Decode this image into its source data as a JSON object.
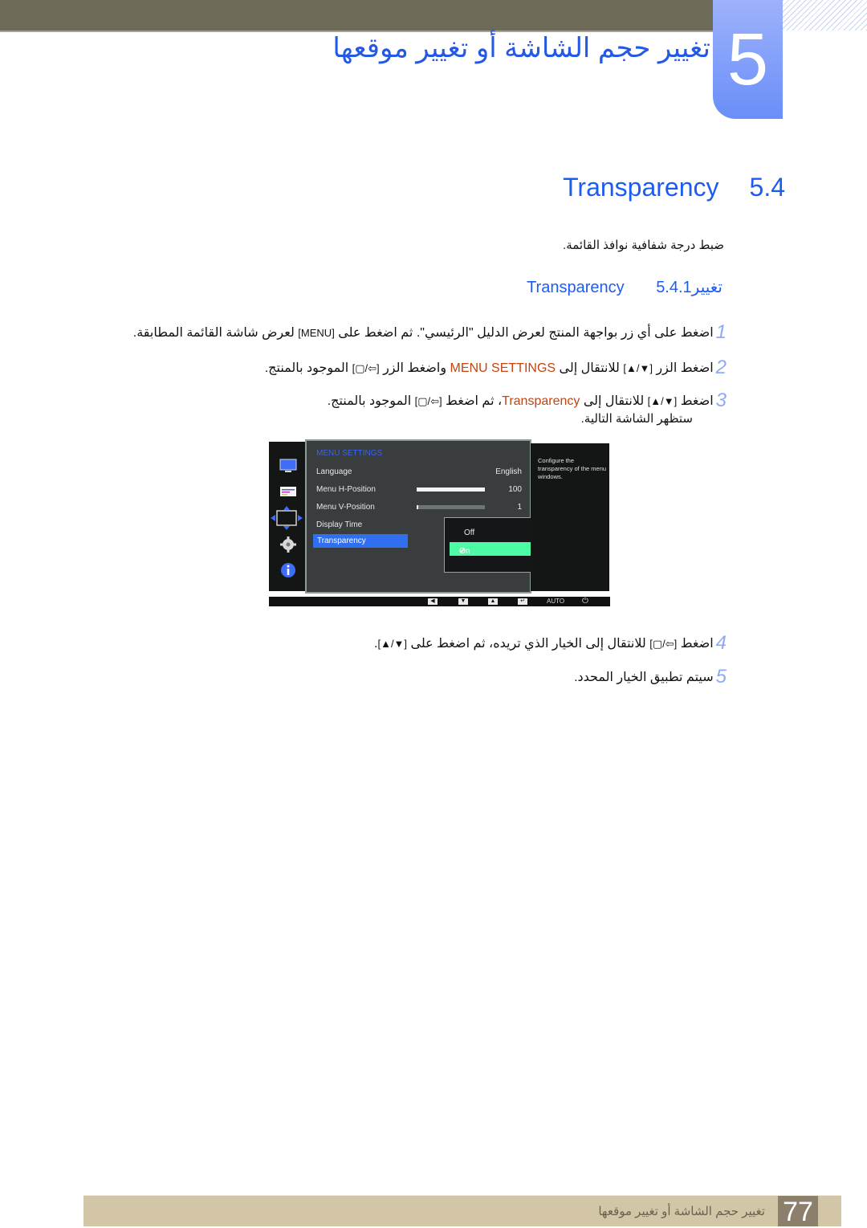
{
  "chapter": {
    "number": "5",
    "title": "تغيير حجم الشاشة أو تغيير موقعها"
  },
  "section": {
    "number": "5.4",
    "title": "Transparency",
    "intro": "ضبط درجة شفافية نوافذ القائمة."
  },
  "subsection": {
    "number": "5.4.1",
    "title_ar": "تغيير",
    "title_en": "Transparency"
  },
  "steps": [
    {
      "n": "1",
      "text_a": "اضغط على أي زر بواجهة المنتج لعرض الدليل \"الرئيسي\". ثم اضغط على ",
      "key": "[MENU]",
      "text_b": " لعرض شاشة القائمة المطابقة."
    },
    {
      "n": "2",
      "text_a": "اضغط الزر ",
      "key": "[▼/▲]",
      "text_b": " للانتقال إلى ",
      "highlight": "MENU SETTINGS",
      "text_c": " واضغط الزر ",
      "key2": "[⇦/▢]",
      "text_d": " الموجود بالمنتج."
    },
    {
      "n": "3",
      "text_a": "اضغط ",
      "key": "[▼/▲]",
      "text_b": " للانتقال إلى ",
      "highlight": "Transparency",
      "text_c": "، ثم اضغط ",
      "key2": "[⇦/▢]",
      "text_d": " الموجود بالمنتج.",
      "continuation": "ستظهر الشاشة التالية."
    },
    {
      "n": "4",
      "text_a": "اضغط ",
      "key": "[⇦/▢]",
      "text_b": " للانتقال إلى الخيار الذي تريده، ثم اضغط على ",
      "key2": "[▼/▲]",
      "text_c": "."
    },
    {
      "n": "5",
      "text_a": "سيتم تطبيق الخيار المحدد."
    }
  ],
  "osd": {
    "icons": [
      "monitor-icon",
      "menu-lines-icon",
      "position-arrows-icon",
      "gear-icon",
      "info-icon"
    ],
    "heading": "MENU SETTINGS",
    "rows": [
      {
        "label": "Language",
        "value": "English"
      },
      {
        "label": "Menu H-Position",
        "value": "100",
        "level": 1.0
      },
      {
        "label": "Menu V-Position",
        "value": "1",
        "level": 0.01
      },
      {
        "label": "Display Time"
      },
      {
        "label": "Transparency",
        "selected": true
      }
    ],
    "popup": {
      "options": [
        {
          "label": "Off",
          "selected": false
        },
        {
          "label": "On",
          "selected": true
        }
      ]
    },
    "help": "Configure the transparency of the menu windows.",
    "keys": {
      "left": "◀",
      "down": "▼",
      "up": "▲",
      "enter": "↵",
      "auto": "AUTO",
      "power": "⏻"
    },
    "colors": {
      "heading": "#3b63f0",
      "selected_row": "#2f6ff0",
      "selected_option": "#4dfaa5"
    }
  },
  "footer": {
    "page_number": "77",
    "title": "تغيير حجم الشاشة أو تغيير موقعها"
  }
}
